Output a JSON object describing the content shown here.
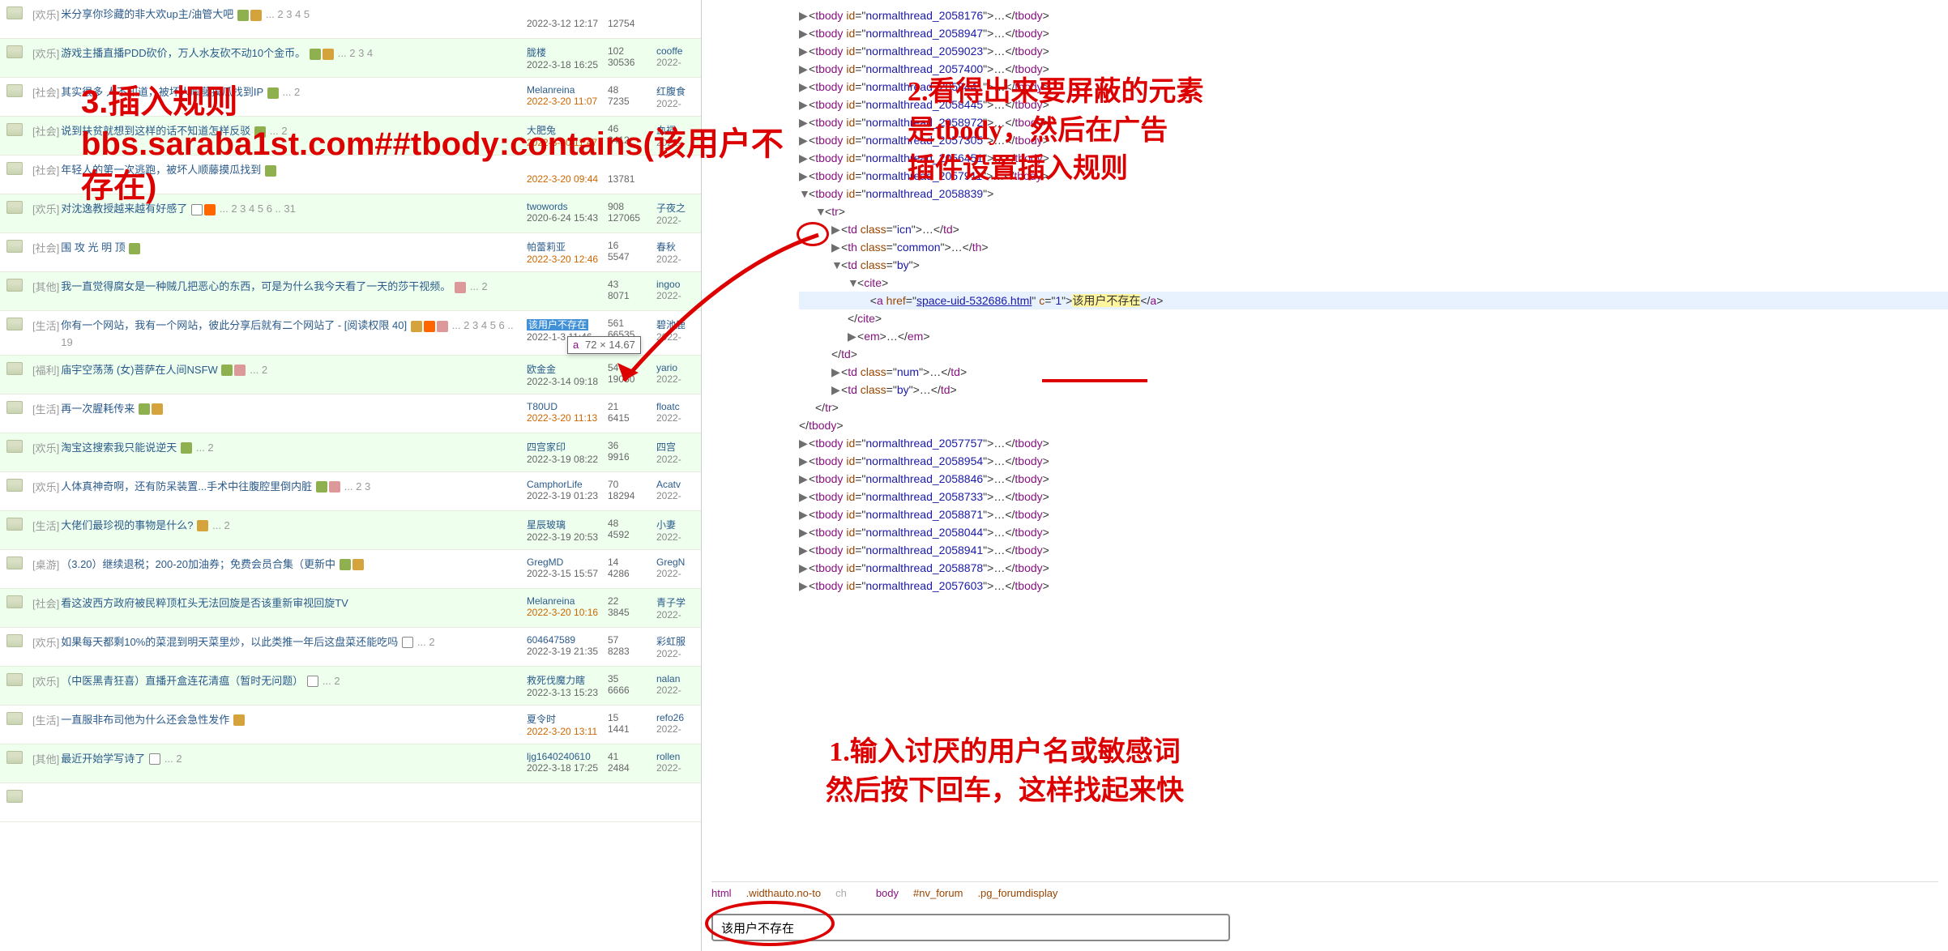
{
  "annotations": {
    "step1": "1.输入讨厌的用户名或敏感词\n然后按下回车，这样找起来快",
    "step2": "2.看得出来要屏蔽的元素\n是tbody，然后在广告\n插件设置插入规则",
    "step3_a": "3.插入规则",
    "step3_b": "bbs.saraba1st.com##tbody:contains(该用户不存在)"
  },
  "tooltip": {
    "tag": "a",
    "dim": "72 × 14.67"
  },
  "highlighted_user": "该用户不存在",
  "search_value": "该用户不存在",
  "breadcrumb": [
    {
      "tag": "html",
      "cls": ".widthauto.no-to",
      "trunc": "ch"
    },
    {
      "tag": "body",
      "id": "#nv_forum",
      "cls": ".pg_forumdisplay"
    }
  ],
  "dom": {
    "pre": [
      "normalthread_2058176",
      "normalthread_2058947",
      "normalthread_2059023",
      "normalthread_2057400",
      "normalthread_2058441",
      "normalthread_2058445",
      "normalthread_2058972",
      "normalthread_2057305",
      "normalthread_2056451",
      "normalthread_2057911"
    ],
    "open_id": "normalthread_2058839",
    "link_href": "space-uid-532686.html",
    "link_c": "1",
    "link_text": "该用户不存在",
    "post": [
      "normalthread_2057757",
      "normalthread_2058954",
      "normalthread_2058846",
      "normalthread_2058733",
      "normalthread_2058871",
      "normalthread_2058044",
      "normalthread_2058941",
      "normalthread_2058878",
      "normalthread_2057603"
    ]
  },
  "threads": [
    {
      "cat": "[欢乐]",
      "title": "米分享你珍藏的非大欢up主/油管大吧",
      "icons": [
        "att",
        "img"
      ],
      "ext": "... 2 3 4 5",
      "auth": "",
      "date": "2022-3-12 12:17",
      "dateCls": "blk",
      "replies": "",
      "views": "12754",
      "lu": "",
      "ld": ""
    },
    {
      "cat": "[欢乐]",
      "title": "游戏主播直播PDD砍价，万人水友砍不动10个金币。",
      "icons": [
        "att",
        "img"
      ],
      "ext": "... 2 3 4",
      "auth": "胧楼",
      "date": "2022-3-18 16:25",
      "dateCls": "blk",
      "replies": "102",
      "views": "30536",
      "lu": "cooffe",
      "ld": "2022-"
    },
    {
      "cat": "[社会]",
      "title": "其实很多 人不知道，被坏人顺藤摸瓜找到IP",
      "icons": [
        "att"
      ],
      "ext": "... 2",
      "auth": "Melanreina",
      "date": "2022-3-20 11:07",
      "replies": "48",
      "views": "7235",
      "lu": "红腹食",
      "ld": "2022-"
    },
    {
      "cat": "[社会]",
      "title": "说到扶贫就想到这样的话不知道怎样反驳",
      "icons": [
        "att"
      ],
      "ext": "... 2",
      "auth": "大肥兔",
      "date": "2022-3-20 11:47",
      "replies": "46",
      "views": "3412",
      "lu": "血祠",
      "ld": "2022-"
    },
    {
      "cat": "[社会]",
      "title": "年轻人的第一次逃跑，被坏人顺藤摸瓜找到",
      "icons": [
        "att"
      ],
      "ext": "",
      "auth": "",
      "date": "2022-3-20 09:44",
      "replies": "",
      "views": "13781",
      "lu": "",
      "ld": ""
    },
    {
      "cat": "[欢乐]",
      "title": "对沈逸教授越来越有好感了",
      "icons": [
        "mob",
        "fire"
      ],
      "ext": "... 2 3 4 5 6 .. 31",
      "auth": "twowords",
      "date": "2020-6-24 15:43",
      "dateCls": "blk",
      "replies": "908",
      "views": "127065",
      "lu": "子夜之",
      "ld": "2022-"
    },
    {
      "cat": "[社会]",
      "title": "围 攻 光 明 顶",
      "icons": [
        "att"
      ],
      "ext": "",
      "auth": "帕蕾莉亚",
      "date": "2022-3-20 12:46",
      "replies": "16",
      "views": "5547",
      "lu": "春秋",
      "ld": "2022-"
    },
    {
      "cat": "[其他]",
      "title": "我一直觉得腐女是一种贼几把恶心的东西，可是为什么我今天看了一天的莎干视频。",
      "icons": [
        "ag"
      ],
      "ext": "... 2",
      "auth": "",
      "date": "",
      "tip": true,
      "replies": "43",
      "views": "8071",
      "lu": "ingoo",
      "ld": "2022-"
    },
    {
      "cat": "[生活]",
      "title": "你有一个网站，我有一个网站，彼此分享后就有二个网站了 - [阅读权限 40]",
      "icons": [
        "img",
        "fire",
        "ag"
      ],
      "ext": "... 2 3 4 5 6 .. 19",
      "auth": "",
      "date": "2022-1-3 11:46",
      "dateCls": "blk",
      "replies": "561",
      "views": "66535",
      "lu": "碧池鹿",
      "ld": "2022-",
      "hi": true
    },
    {
      "cat": "[福利]",
      "title": "庙宇空荡荡 (女)菩萨在人间NSFW",
      "icons": [
        "att",
        "ag"
      ],
      "ext": "... 2",
      "auth": "欧金金",
      "date": "2022-3-14 09:18",
      "dateCls": "blk",
      "replies": "54",
      "views": "19060",
      "lu": "yario",
      "ld": "2022-"
    },
    {
      "cat": "[生活]",
      "title": "再一次腥耗传来",
      "icons": [
        "att",
        "img"
      ],
      "ext": "",
      "auth": "T80UD",
      "date": "2022-3-20 11:13",
      "replies": "21",
      "views": "6415",
      "lu": "floatc",
      "ld": "2022-"
    },
    {
      "cat": "[欢乐]",
      "title": "淘宝这搜索我只能说逆天",
      "icons": [
        "att"
      ],
      "ext": "... 2",
      "auth": "四宫家印",
      "date": "2022-3-19 08:22",
      "dateCls": "blk",
      "replies": "36",
      "views": "9916",
      "lu": "四宫",
      "ld": "2022-"
    },
    {
      "cat": "[欢乐]",
      "title": "人体真神奇啊，还有防呆装置...手术中往腹腔里倒内脏",
      "icons": [
        "att",
        "ag"
      ],
      "ext": "... 2 3",
      "auth": "CamphorLife",
      "date": "2022-3-19 01:23",
      "dateCls": "blk",
      "replies": "70",
      "views": "18294",
      "lu": "Acatv",
      "ld": "2022-"
    },
    {
      "cat": "[生活]",
      "title": "大佬们最珍视的事物是什么?",
      "icons": [
        "img"
      ],
      "ext": "... 2",
      "auth": "星辰玻璃",
      "date": "2022-3-19 20:53",
      "dateCls": "blk",
      "replies": "48",
      "views": "4592",
      "lu": "小妻",
      "ld": "2022-"
    },
    {
      "cat": "[桌游]",
      "title": "（3.20）继续退税；200-20加油券；免费会员合集（更新中",
      "icons": [
        "att",
        "img"
      ],
      "ext": "",
      "auth": "GregMD",
      "date": "2022-3-15 15:57",
      "dateCls": "blk",
      "replies": "14",
      "views": "4286",
      "lu": "GregN",
      "ld": "2022-"
    },
    {
      "cat": "[社会]",
      "title": "看这波西方政府被民粹顶杠头无法回旋是否该重新审视回旋TV",
      "icons": [],
      "ext": "",
      "auth": "Melanreina",
      "date": "2022-3-20 10:16",
      "replies": "22",
      "views": "3845",
      "lu": "青子学",
      "ld": "2022-"
    },
    {
      "cat": "[欢乐]",
      "title": "如果每天都剩10%的菜混到明天菜里炒，以此类推一年后这盘菜还能吃吗",
      "icons": [
        "mob"
      ],
      "ext": "... 2",
      "auth": "604647589",
      "date": "2022-3-19 21:35",
      "dateCls": "blk",
      "replies": "57",
      "views": "8283",
      "lu": "彩虹服",
      "ld": "2022-"
    },
    {
      "cat": "[欢乐]",
      "title": "（中医黑青狂喜）直播开盒连花清瘟（暂时无问题）",
      "icons": [
        "mob"
      ],
      "ext": "... 2",
      "auth": "救死伐魔力瞎",
      "date": "2022-3-13 15:23",
      "dateCls": "blk",
      "replies": "35",
      "views": "6666",
      "lu": "nalan",
      "ld": "2022-"
    },
    {
      "cat": "[生活]",
      "title": "一直服非布司他为什么还会急性发作",
      "icons": [
        "img"
      ],
      "ext": "",
      "auth": "夏令时",
      "date": "2022-3-20 13:11",
      "replies": "15",
      "views": "1441",
      "lu": "refo26",
      "ld": "2022-"
    },
    {
      "cat": "[其他]",
      "title": "最近开始学写诗了",
      "icons": [
        "mob"
      ],
      "ext": "... 2",
      "auth": "ljg1640240610",
      "date": "2022-3-18 17:25",
      "dateCls": "blk",
      "replies": "41",
      "views": "2484",
      "lu": "rollen",
      "ld": "2022-"
    },
    {
      "cat": "",
      "title": "",
      "icons": [],
      "ext": "",
      "auth": "",
      "date": "",
      "replies": "",
      "views": "",
      "lu": "",
      "ld": ""
    }
  ]
}
